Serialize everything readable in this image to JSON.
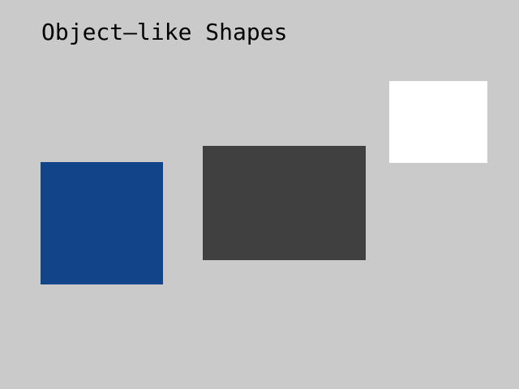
{
  "title": "Object—like Shapes",
  "colors": {
    "background": "#cacaca",
    "title_text": "#000000",
    "blue_square": "#114488",
    "dark_rectangle": "#404040",
    "white_rectangle": "#ffffff"
  }
}
